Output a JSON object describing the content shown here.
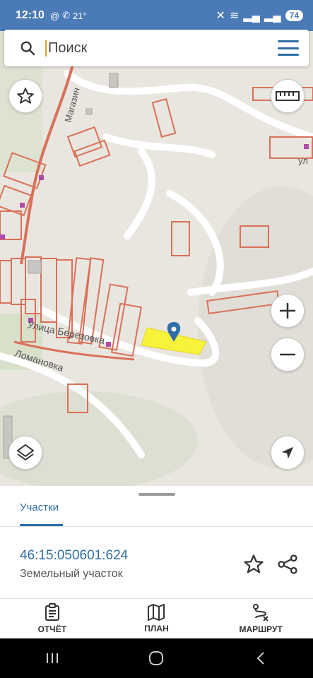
{
  "status_bar": {
    "time": "12:10",
    "temp": "21°",
    "battery": "74"
  },
  "search": {
    "placeholder": "Поиск"
  },
  "map": {
    "street_labels": [
      "Магазин",
      "Улица Березовка",
      "Ломановка",
      "ул"
    ],
    "marker_color": "#2f6ea8",
    "highlight_color": "#f7f23a",
    "parcel_stroke": "#d9705a"
  },
  "sheet": {
    "tab_label": "Участки",
    "parcel_number": "46:15:050601:624",
    "parcel_type": "Земельный участок"
  },
  "bottom_nav": {
    "report_label": "ОТЧЁТ",
    "plan_label": "ПЛАН",
    "route_label": "МАРШРУТ"
  },
  "colors": {
    "accent": "#2f6ea8",
    "status_bar": "#4a7bb7"
  }
}
